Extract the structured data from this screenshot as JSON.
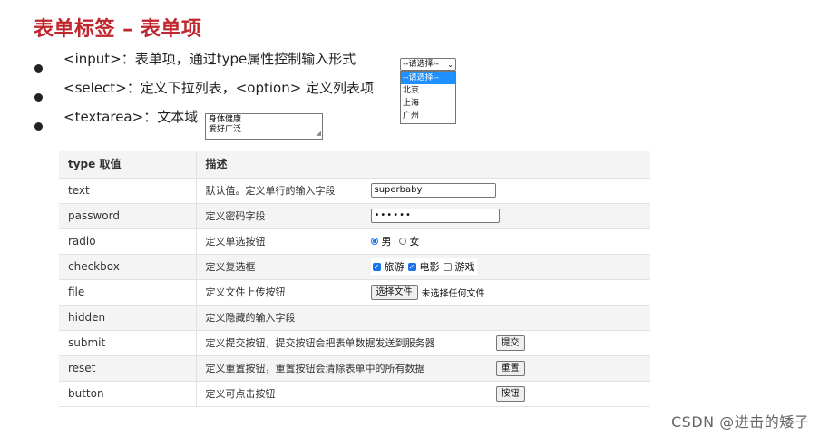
{
  "title": "表单标签 – 表单项",
  "bullets": [
    "<input>：表单项，通过type属性控制输入形式",
    "<select>：定义下拉列表，<option> 定义列表项",
    "<textarea>：文本域"
  ],
  "select_demo": {
    "selected": "--请选择--",
    "options": [
      "--请选择--",
      "北京",
      "上海",
      "广州"
    ]
  },
  "textarea_demo": {
    "line1": "身体健康",
    "line2": "爱好广泛"
  },
  "table": {
    "headers": [
      "type 取值",
      "描述"
    ],
    "rows": [
      {
        "type": "text",
        "desc": "默认值。定义单行的输入字段"
      },
      {
        "type": "password",
        "desc": "定义密码字段"
      },
      {
        "type": "radio",
        "desc": "定义单选按钮"
      },
      {
        "type": "checkbox",
        "desc": "定义复选框"
      },
      {
        "type": "file",
        "desc": "定义文件上传按钮"
      },
      {
        "type": "hidden",
        "desc": "定义隐藏的输入字段"
      },
      {
        "type": "submit",
        "desc": "定义提交按钮，提交按钮会把表单数据发送到服务器"
      },
      {
        "type": "reset",
        "desc": "定义重置按钮，重置按钮会清除表单中的所有数据"
      },
      {
        "type": "button",
        "desc": "定义可点击按钮"
      }
    ]
  },
  "widgets": {
    "text_value": "superbaby",
    "password_mask": "••••••",
    "radio_male": "男",
    "radio_female": "女",
    "cb_travel": "旅游",
    "cb_movie": "电影",
    "cb_game": "游戏",
    "file_button": "选择文件",
    "file_status": "未选择任何文件",
    "submit_label": "提交",
    "reset_label": "重置",
    "button_label": "按钮"
  },
  "watermark": "CSDN @进击的矮子",
  "colors": {
    "title": "#c0262d",
    "accent": "#1a73e8"
  }
}
